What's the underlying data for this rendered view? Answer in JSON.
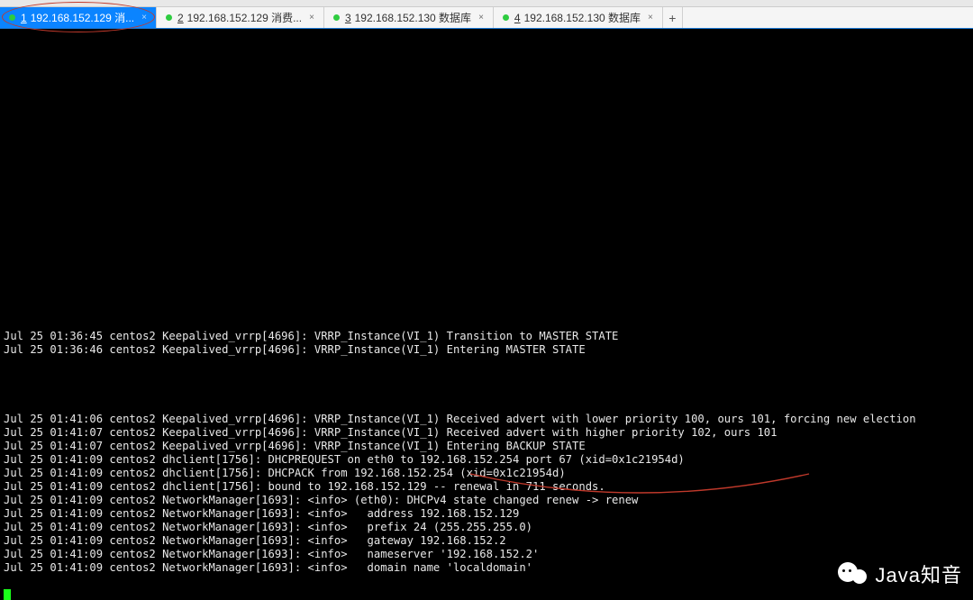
{
  "top_strip_hint": "",
  "tabs": [
    {
      "num": "1",
      "label": "192.168.152.129 消...",
      "active": true
    },
    {
      "num": "2",
      "label": "192.168.152.129 消费...",
      "active": false
    },
    {
      "num": "3",
      "label": "192.168.152.130 数据库",
      "active": false
    },
    {
      "num": "4",
      "label": "192.168.152.130 数据库",
      "active": false
    }
  ],
  "add_tab": "+",
  "log_block1": [
    "Jul 25 01:36:45 centos2 Keepalived_vrrp[4696]: VRRP_Instance(VI_1) Transition to MASTER STATE",
    "Jul 25 01:36:46 centos2 Keepalived_vrrp[4696]: VRRP_Instance(VI_1) Entering MASTER STATE"
  ],
  "log_block2": [
    "Jul 25 01:41:06 centos2 Keepalived_vrrp[4696]: VRRP_Instance(VI_1) Received advert with lower priority 100, ours 101, forcing new election",
    "Jul 25 01:41:07 centos2 Keepalived_vrrp[4696]: VRRP_Instance(VI_1) Received advert with higher priority 102, ours 101",
    "Jul 25 01:41:07 centos2 Keepalived_vrrp[4696]: VRRP_Instance(VI_1) Entering BACKUP STATE",
    "Jul 25 01:41:09 centos2 dhclient[1756]: DHCPREQUEST on eth0 to 192.168.152.254 port 67 (xid=0x1c21954d)",
    "Jul 25 01:41:09 centos2 dhclient[1756]: DHCPACK from 192.168.152.254 (xid=0x1c21954d)",
    "Jul 25 01:41:09 centos2 dhclient[1756]: bound to 192.168.152.129 -- renewal in 711 seconds.",
    "Jul 25 01:41:09 centos2 NetworkManager[1693]: <info> (eth0): DHCPv4 state changed renew -> renew",
    "Jul 25 01:41:09 centos2 NetworkManager[1693]: <info>   address 192.168.152.129",
    "Jul 25 01:41:09 centos2 NetworkManager[1693]: <info>   prefix 24 (255.255.255.0)",
    "Jul 25 01:41:09 centos2 NetworkManager[1693]: <info>   gateway 192.168.152.2",
    "Jul 25 01:41:09 centos2 NetworkManager[1693]: <info>   nameserver '192.168.152.2'",
    "Jul 25 01:41:09 centos2 NetworkManager[1693]: <info>   domain name 'localdomain'"
  ],
  "watermark": "Java知音",
  "colors": {
    "tab_active_bg": "#0b84ff",
    "dot": "#2ecc40",
    "terminal_bg": "#000",
    "text": "#e8e8e8",
    "annotation": "#c0392b"
  }
}
